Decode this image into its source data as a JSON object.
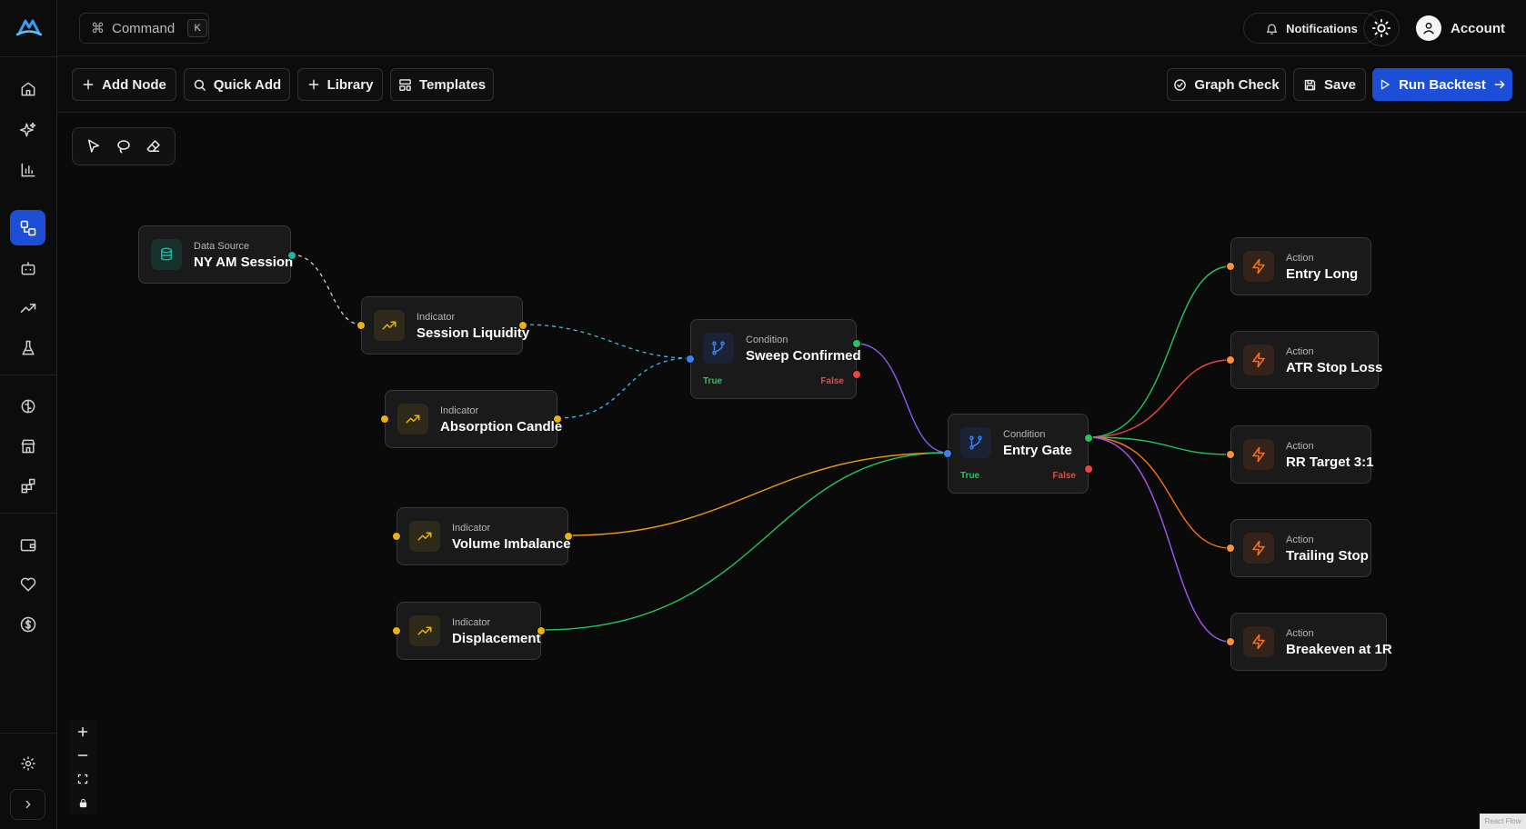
{
  "header": {
    "command_label": "Command",
    "command_shortcut": "K",
    "notifications_label": "Notifications",
    "account_label": "Account"
  },
  "toolbar": {
    "add_node": "Add Node",
    "quick_add": "Quick Add",
    "library": "Library",
    "templates": "Templates",
    "graph_check": "Graph Check",
    "save": "Save",
    "run_backtest": "Run Backtest"
  },
  "colors": {
    "accent": "#1d4ed8",
    "datasource": "#14b8a6",
    "indicator": "#eab308",
    "condition": "#3b82f6",
    "action": "#f97316",
    "true": "#22c55e",
    "false": "#ef4444"
  },
  "nodes": {
    "ny_am_session": {
      "type": "Data Source",
      "title": "NY AM Session",
      "icon": "database-icon"
    },
    "session_liquidity": {
      "type": "Indicator",
      "title": "Session Liquidity",
      "icon": "trending-up-icon"
    },
    "absorption_candle": {
      "type": "Indicator",
      "title": "Absorption Candle",
      "icon": "trending-up-icon"
    },
    "volume_imbalance": {
      "type": "Indicator",
      "title": "Volume Imbalance",
      "icon": "trending-up-icon"
    },
    "displacement": {
      "type": "Indicator",
      "title": "Displacement",
      "icon": "trending-up-icon"
    },
    "sweep_confirmed": {
      "type": "Condition",
      "title": "Sweep Confirmed",
      "true_label": "True",
      "false_label": "False",
      "icon": "git-branch-icon"
    },
    "entry_gate": {
      "type": "Condition",
      "title": "Entry Gate",
      "true_label": "True",
      "false_label": "False",
      "icon": "git-branch-icon"
    },
    "entry_long": {
      "type": "Action",
      "title": "Entry Long",
      "icon": "lightning-icon"
    },
    "atr_stop_loss": {
      "type": "Action",
      "title": "ATR Stop Loss",
      "icon": "lightning-icon"
    },
    "rr_target": {
      "type": "Action",
      "title": "RR Target 3:1",
      "icon": "lightning-icon"
    },
    "trailing_stop": {
      "type": "Action",
      "title": "Trailing Stop",
      "icon": "lightning-icon"
    },
    "breakeven": {
      "type": "Action",
      "title": "Breakeven at 1R",
      "icon": "lightning-icon"
    }
  },
  "attribution": "React Flow"
}
